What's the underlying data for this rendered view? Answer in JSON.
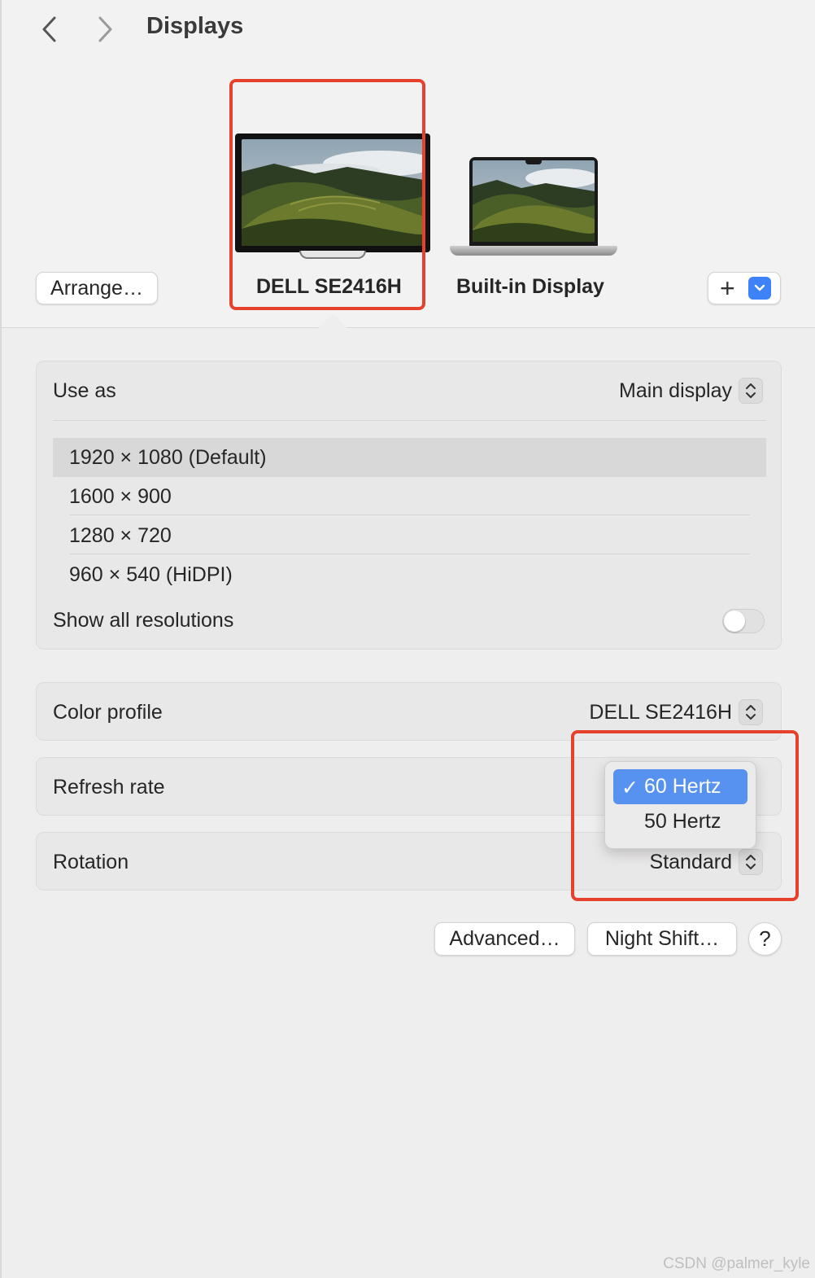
{
  "window": {
    "title": "Displays"
  },
  "header": {
    "arrange_label": "Arrange…",
    "add_label": "+",
    "displays": [
      {
        "name": "DELL SE2416H",
        "selected": true
      },
      {
        "name": "Built-in Display",
        "selected": false
      }
    ]
  },
  "use_as": {
    "label": "Use as",
    "value": "Main display"
  },
  "resolutions": {
    "items": [
      {
        "label": "1920 × 1080 (Default)",
        "selected": true
      },
      {
        "label": "1600 × 900",
        "selected": false
      },
      {
        "label": "1280 × 720",
        "selected": false
      },
      {
        "label": "960 × 540 (HiDPI)",
        "selected": false
      }
    ],
    "show_all_label": "Show all resolutions",
    "show_all_on": false
  },
  "color_profile": {
    "label": "Color profile",
    "value": "DELL SE2416H"
  },
  "refresh_rate": {
    "label": "Refresh rate",
    "options": [
      {
        "label": "60 Hertz",
        "checked": true
      },
      {
        "label": "50 Hertz",
        "checked": false
      }
    ],
    "check_glyph": "✓"
  },
  "rotation": {
    "label": "Rotation",
    "value": "Standard"
  },
  "footer": {
    "advanced_label": "Advanced…",
    "night_shift_label": "Night Shift…",
    "help_label": "?"
  },
  "watermark": "CSDN @palmer_kyle",
  "colors": {
    "accent_blue": "#3d83f7",
    "menu_highlight": "#5892f0",
    "annotation_red": "#e5412d"
  }
}
